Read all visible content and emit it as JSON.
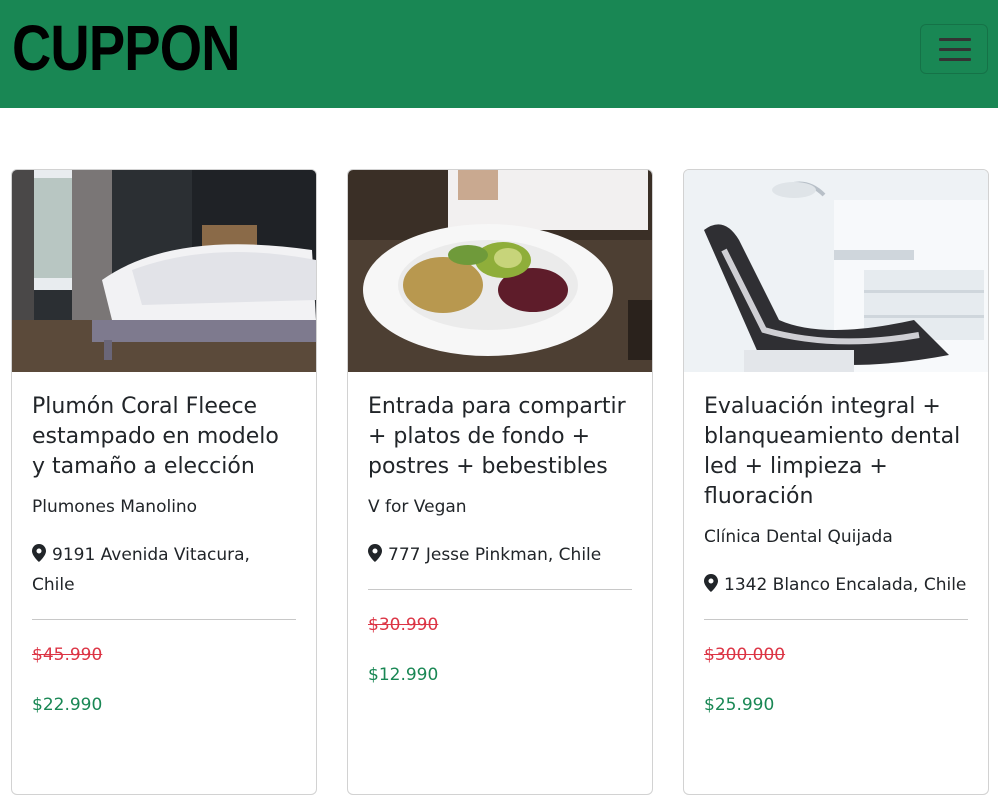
{
  "navbar": {
    "brand": "CUPPON",
    "toggler_icon": "hamburger-icon",
    "background": "#198754"
  },
  "colors": {
    "old_price": "#dc3545",
    "new_price": "#198754"
  },
  "cards": [
    {
      "title": "Plumón Coral Fleece estampado en modelo y tamaño a elección",
      "vendor": "Plumones Manolino",
      "address": "9191 Avenida Vitacura, Chile",
      "old_price": "$45.990",
      "new_price": "$22.990",
      "image": "bedroom-photo"
    },
    {
      "title": "Entrada para compartir + platos de fondo + postres + bebestibles",
      "vendor": "V for Vegan",
      "address": "777 Jesse Pinkman, Chile",
      "old_price": "$30.990",
      "new_price": "$12.990",
      "image": "vegan-dish-photo"
    },
    {
      "title": "Evaluación integral + blanqueamiento dental led + limpieza + fluoración",
      "vendor": "Clínica Dental Quijada",
      "address": "1342 Blanco Encalada, Chile",
      "old_price": "$300.000",
      "new_price": "$25.990",
      "image": "dental-chair-photo"
    }
  ]
}
